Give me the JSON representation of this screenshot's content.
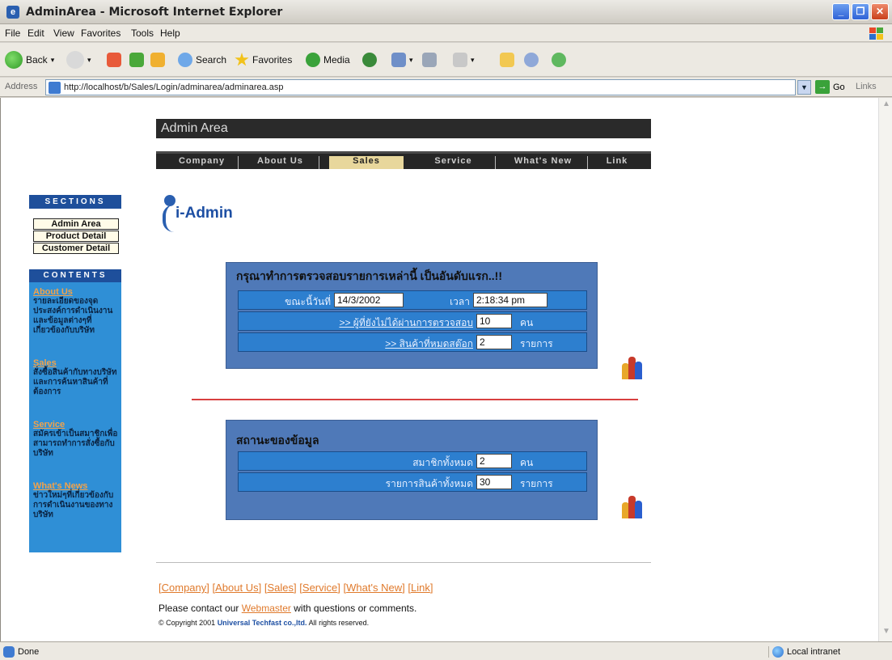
{
  "window": {
    "title": "AdminArea - Microsoft Internet Explorer"
  },
  "menu": [
    "File",
    "Edit",
    "View",
    "Favorites",
    "Tools",
    "Help"
  ],
  "toolbar": {
    "back": "Back",
    "search": "Search",
    "favorites": "Favorites",
    "media": "Media"
  },
  "address": {
    "label": "Address",
    "url": "http://localhost/b/Sales/Login/adminarea/adminarea.asp",
    "go": "Go",
    "links": "Links"
  },
  "page": {
    "header": "Admin Area",
    "nav": [
      "Company",
      "About Us",
      "Sales",
      "Service",
      "What's New",
      "Link"
    ],
    "nav_active": "Sales",
    "sections_title": "SECTIONS",
    "sections": [
      "Admin Area",
      "Product Detail",
      "Customer Detail"
    ],
    "contents_title": "CONTENTS",
    "contents": [
      {
        "title": "About Us",
        "desc": "รายละเอียดของจุดประสงค์การดำเนินงานและข้อมูลต่างๆที่เกี่ยวข้องกับบริษัท"
      },
      {
        "title": "Sales",
        "desc": "สั่งซื้อสินค้ากับทางบริษัทและการค้นหาสินค้าที่ต้องการ"
      },
      {
        "title": "Service",
        "desc": "สมัครเข้าเป็นสมาชิกเพื่อสามารถทำการสั่งซื้อกับบริษัท"
      },
      {
        "title": "What's News",
        "desc": "ข่าวใหม่ๆที่เกี่ยวข้องกับการดำเนินงานของทางบริษัท"
      }
    ],
    "logo_text": "i-Admin",
    "check_panel": {
      "title": "กรุณาทำการตรวจสอบรายการเหล่านี้ เป็นอันดับแรก..!!",
      "date_label": "ขณะนี้วันที่",
      "date_value": "14/3/2002",
      "time_label": "เวลา",
      "time_value": "2:18:34 pm",
      "pending_label": ">> ผู้ที่ยังไม่ได้ผ่านการตรวจสอบ",
      "pending_value": "10",
      "pending_unit": "คน",
      "outofstock_label": ">> สินค้าที่หมดสต๊อก",
      "outofstock_value": "2",
      "outofstock_unit": "รายการ"
    },
    "status_panel": {
      "title": "สถานะของข้อมูล",
      "members_label": "สมาชิกทั้งหมด",
      "members_value": "2",
      "members_unit": "คน",
      "products_label": "รายการสินค้าทั้งหมด",
      "products_value": "30",
      "products_unit": "รายการ"
    },
    "footer_links": [
      "Company",
      "About Us",
      "Sales",
      "Service",
      "What's New",
      "Link"
    ],
    "contact_pre": "Please contact our",
    "contact_link": "Webmaster",
    "contact_post": "with questions or comments.",
    "copyright_pre": "© Copyright 2001",
    "copyright_company": "Universal Techfast co.,ltd.",
    "copyright_post": "All rights reserved."
  },
  "status": {
    "left": "Done",
    "zone": "Local intranet"
  }
}
